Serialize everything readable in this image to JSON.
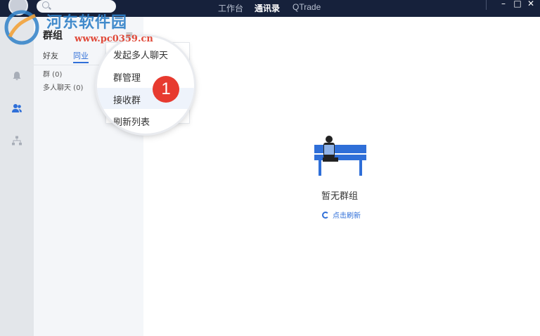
{
  "topbar": {
    "search_placeholder": "",
    "nav": [
      "工作台",
      "通讯录",
      "QTrade"
    ],
    "active_nav": "通讯录",
    "window_controls": [
      "–",
      "□",
      "✕"
    ]
  },
  "watermark": {
    "title": "河东软件园",
    "url": "www.pc0359.cn"
  },
  "rail": {
    "icons": [
      "bell-icon",
      "contacts-icon",
      "org-chart-icon"
    ],
    "accent": "#2f6fd8"
  },
  "panel": {
    "title": "群组",
    "tabs": [
      "好友",
      "同业"
    ],
    "active_tab": "同业",
    "rows": [
      "群 (0)",
      "多人聊天 (0)"
    ]
  },
  "popup_menu": {
    "items": [
      "发起多人聊天",
      "群管理",
      "接收群",
      "刷新列表"
    ],
    "highlighted": "接收群"
  },
  "annotation": {
    "badge": "1",
    "color": "#e73a2f"
  },
  "empty_state": {
    "title": "暂无群组",
    "refresh_label": "点击刷新"
  }
}
